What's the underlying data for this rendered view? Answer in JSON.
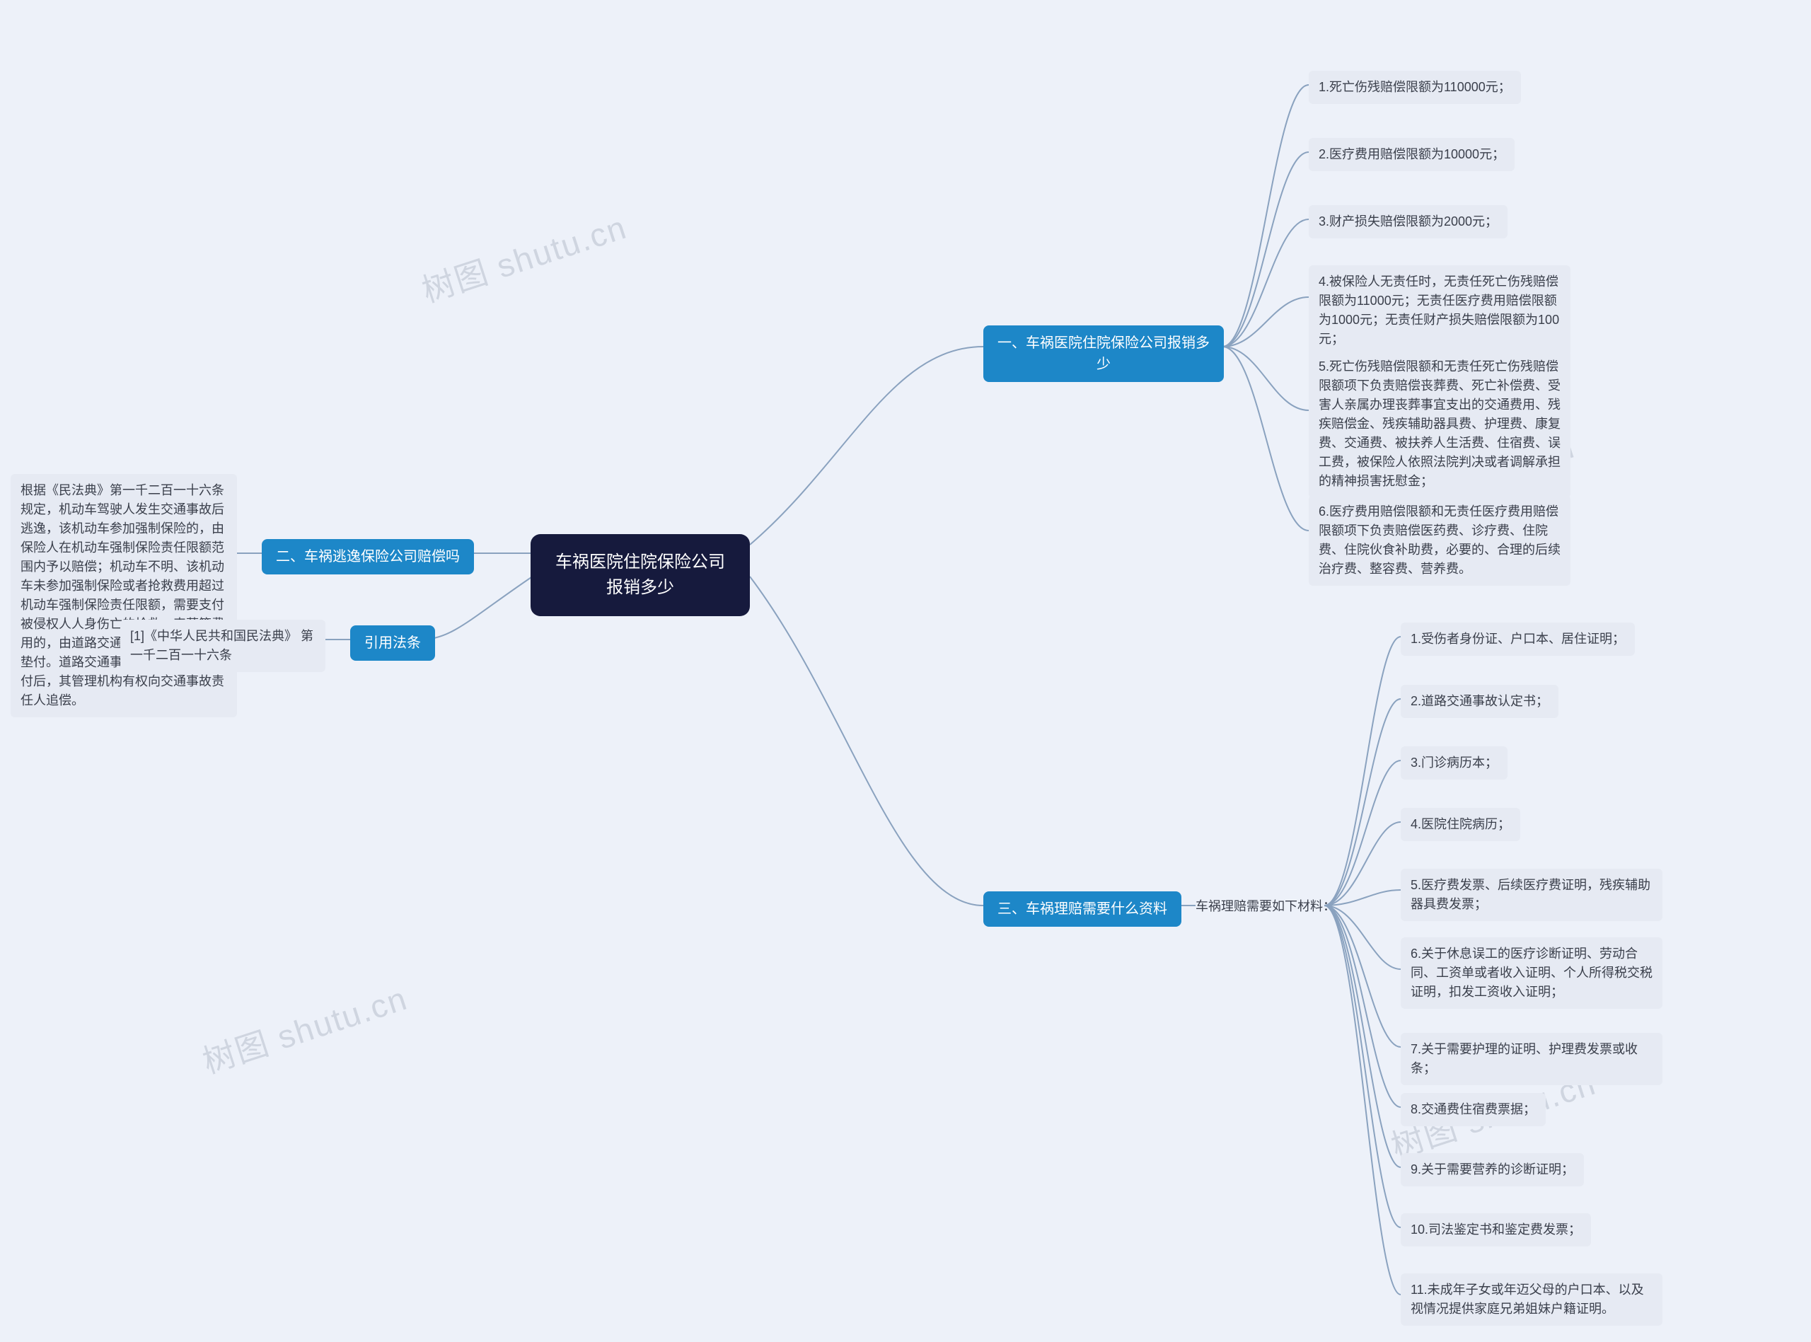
{
  "root": {
    "title": "车祸医院住院保险公司报销多少"
  },
  "watermark": "树图 shutu.cn",
  "b1": {
    "label": "一、车祸医院住院保险公司报销多少",
    "items": [
      "1.死亡伤残赔偿限额为110000元；",
      "2.医疗费用赔偿限额为10000元；",
      "3.财产损失赔偿限额为2000元；",
      "4.被保险人无责任时，无责任死亡伤残赔偿限额为11000元；无责任医疗费用赔偿限额为1000元；无责任财产损失赔偿限额为100元；",
      "5.死亡伤残赔偿限额和无责任死亡伤残赔偿限额项下负责赔偿丧葬费、死亡补偿费、受害人亲属办理丧葬事宜支出的交通费用、残疾赔偿金、残疾辅助器具费、护理费、康复费、交通费、被扶养人生活费、住宿费、误工费，被保险人依照法院判决或者调解承担的精神损害抚慰金；",
      "6.医疗费用赔偿限额和无责任医疗费用赔偿限额项下负责赔偿医药费、诊疗费、住院费、住院伙食补助费，必要的、合理的后续治疗费、整容费、营养费。"
    ]
  },
  "b2": {
    "label": "二、车祸逃逸保险公司赔偿吗",
    "text": "根据《民法典》第一千二百一十六条规定，机动车驾驶人发生交通事故后逃逸，该机动车参加强制保险的，由保险人在机动车强制保险责任限额范围内予以赔偿；机动车不明、该机动车未参加强制保险或者抢救费用超过机动车强制保险责任限额，需要支付被侵权人人身伤亡的抢救、丧葬等费用的，由道路交通事故社会救助基金垫付。道路交通事故社会救助基金垫付后，其管理机构有权向交通事故责任人追偿。"
  },
  "b3": {
    "label": "三、车祸理赔需要什么资料",
    "mid": "车祸理赔需要如下材料：",
    "items": [
      "1.受伤者身份证、户口本、居住证明；",
      "2.道路交通事故认定书；",
      "3.门诊病历本；",
      "4.医院住院病历；",
      "5.医疗费发票、后续医疗费证明，残疾辅助器具费发票；",
      "6.关于休息误工的医疗诊断证明、劳动合同、工资单或者收入证明、个人所得税交税证明，扣发工资收入证明；",
      "7.关于需要护理的证明、护理费发票或收条；",
      "8.交通费住宿费票据；",
      "9.关于需要营养的诊断证明；",
      "10.司法鉴定书和鉴定费发票；",
      "11.未成年子女或年迈父母的户口本、以及视情况提供家庭兄弟姐妹户籍证明。"
    ]
  },
  "bLaw": {
    "label": "引用法条",
    "text": "[1]《中华人民共和国民法典》 第一千二百一十六条"
  }
}
